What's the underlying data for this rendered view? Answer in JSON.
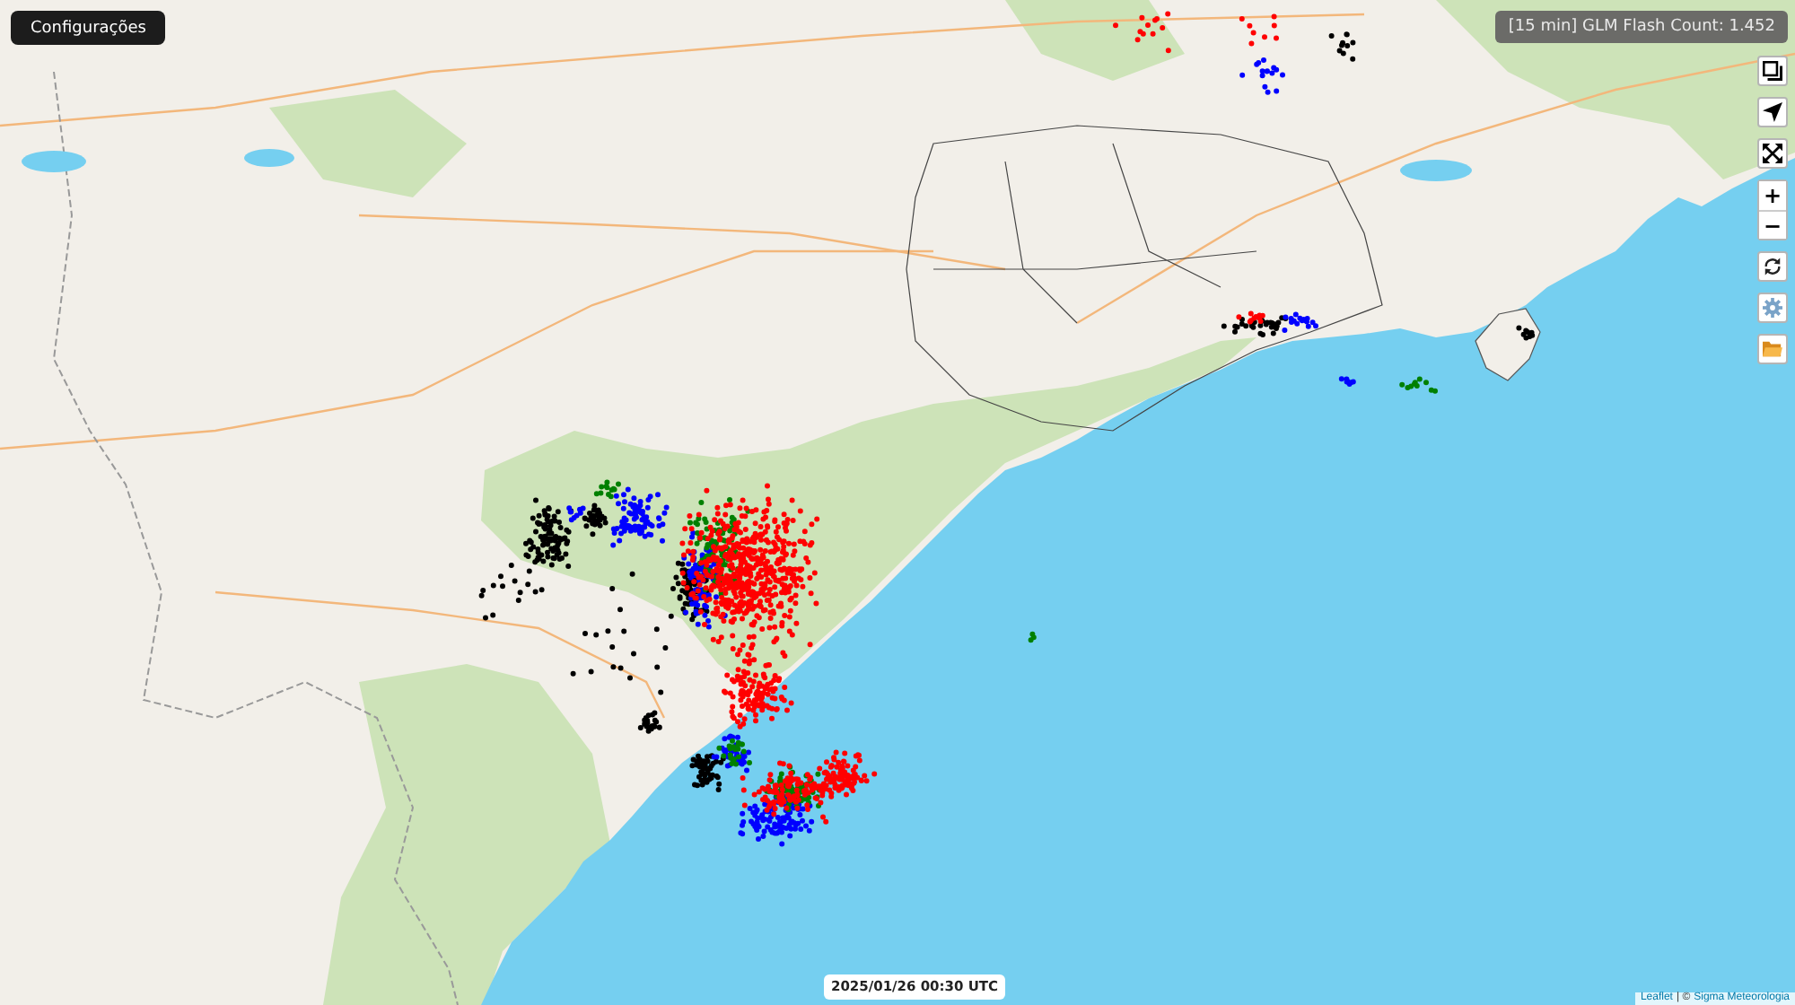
{
  "settings_button": {
    "label": "Configurações"
  },
  "flash_count_badge": {
    "text": "[15 min] GLM Flash Count: 1.452"
  },
  "map": {
    "lightning_series": [
      {
        "color": "#000000"
      },
      {
        "color": "#0000ff"
      },
      {
        "color": "#008000"
      },
      {
        "color": "#ff0000"
      }
    ]
  },
  "map_controls": [
    {
      "kind": "layers"
    },
    {
      "kind": "locate"
    },
    {
      "kind": "fullscreen"
    },
    {
      "kind": "zoom",
      "zoom_in": "+",
      "zoom_out": "−"
    },
    {
      "kind": "refresh"
    },
    {
      "kind": "settings"
    },
    {
      "kind": "folder"
    }
  ],
  "timestamp": {
    "text": "2025/01/26 00:30 UTC"
  },
  "attribution": {
    "leaflet_link": "Leaflet",
    "text": "| ©",
    "owner_link": "Sigma Meteorologia"
  }
}
